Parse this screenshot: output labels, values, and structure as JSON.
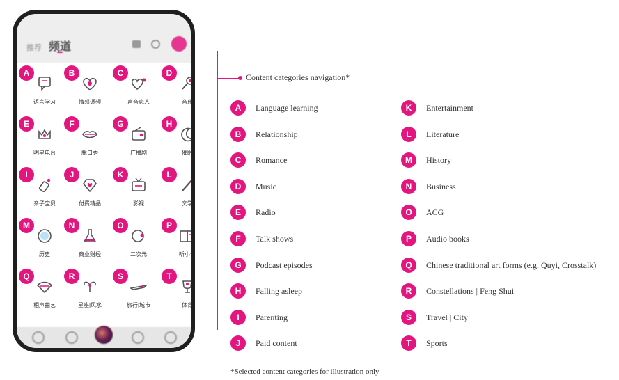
{
  "phone": {
    "tab_faded": "推荐",
    "tab_active": "频道",
    "bottom_icons": [
      "home-icon",
      "chat-icon",
      "play-icon",
      "discover-icon",
      "profile-icon"
    ]
  },
  "channels": [
    {
      "letter": "A",
      "zh": "语言学习",
      "icon": "chat-bubble-icon"
    },
    {
      "letter": "B",
      "zh": "情感调频",
      "icon": "heart-icon"
    },
    {
      "letter": "C",
      "zh": "声音恋人",
      "icon": "heart-sparkle-icon"
    },
    {
      "letter": "D",
      "zh": "音乐",
      "icon": "microphone-icon"
    },
    {
      "letter": "E",
      "zh": "明星电台",
      "icon": "crown-icon"
    },
    {
      "letter": "F",
      "zh": "脱口秀",
      "icon": "lips-icon"
    },
    {
      "letter": "G",
      "zh": "广播剧",
      "icon": "radio-icon"
    },
    {
      "letter": "H",
      "zh": "催眠",
      "icon": "moon-icon"
    },
    {
      "letter": "I",
      "zh": "亲子宝贝",
      "icon": "baby-bottle-icon"
    },
    {
      "letter": "J",
      "zh": "付费精品",
      "icon": "diamond-heart-icon"
    },
    {
      "letter": "K",
      "zh": "影视",
      "icon": "tv-icon"
    },
    {
      "letter": "L",
      "zh": "文学",
      "icon": "pen-icon"
    },
    {
      "letter": "M",
      "zh": "历史",
      "icon": "globe-icon"
    },
    {
      "letter": "N",
      "zh": "商业财经",
      "icon": "flask-icon"
    },
    {
      "letter": "O",
      "zh": "二次元",
      "icon": "anime-face-icon"
    },
    {
      "letter": "P",
      "zh": "听小说",
      "icon": "book-icon"
    },
    {
      "letter": "Q",
      "zh": "相声曲艺",
      "icon": "fan-icon"
    },
    {
      "letter": "R",
      "zh": "星座|风水",
      "icon": "aries-icon"
    },
    {
      "letter": "S",
      "zh": "旅行|城市",
      "icon": "airplane-icon"
    },
    {
      "letter": "T",
      "zh": "体育",
      "icon": "trophy-icon"
    }
  ],
  "nav_title": "Content categories navigation*",
  "categories_left": [
    {
      "letter": "A",
      "label": "Language learning"
    },
    {
      "letter": "B",
      "label": "Relationship"
    },
    {
      "letter": "C",
      "label": "Romance"
    },
    {
      "letter": "D",
      "label": "Music"
    },
    {
      "letter": "E",
      "label": "Radio"
    },
    {
      "letter": "F",
      "label": "Talk shows"
    },
    {
      "letter": "G",
      "label": "Podcast episodes"
    },
    {
      "letter": "H",
      "label": "Falling asleep"
    },
    {
      "letter": "I",
      "label": "Parenting"
    },
    {
      "letter": "J",
      "label": "Paid content"
    }
  ],
  "categories_right": [
    {
      "letter": "K",
      "label": "Entertainment"
    },
    {
      "letter": "L",
      "label": "Literature"
    },
    {
      "letter": "M",
      "label": "History"
    },
    {
      "letter": "N",
      "label": "Business"
    },
    {
      "letter": "O",
      "label": "ACG"
    },
    {
      "letter": "P",
      "label": "Audio books"
    },
    {
      "letter": "Q",
      "label": "Chinese traditional art forms (e.g. Quyi, Crosstalk)"
    },
    {
      "letter": "R",
      "label": "Constellations | Feng Shui"
    },
    {
      "letter": "S",
      "label": "Travel | City"
    },
    {
      "letter": "T",
      "label": "Sports"
    }
  ],
  "footnote": "*Selected content categories for illustration only",
  "colors": {
    "accent": "#e3157f",
    "text": "#333333"
  }
}
